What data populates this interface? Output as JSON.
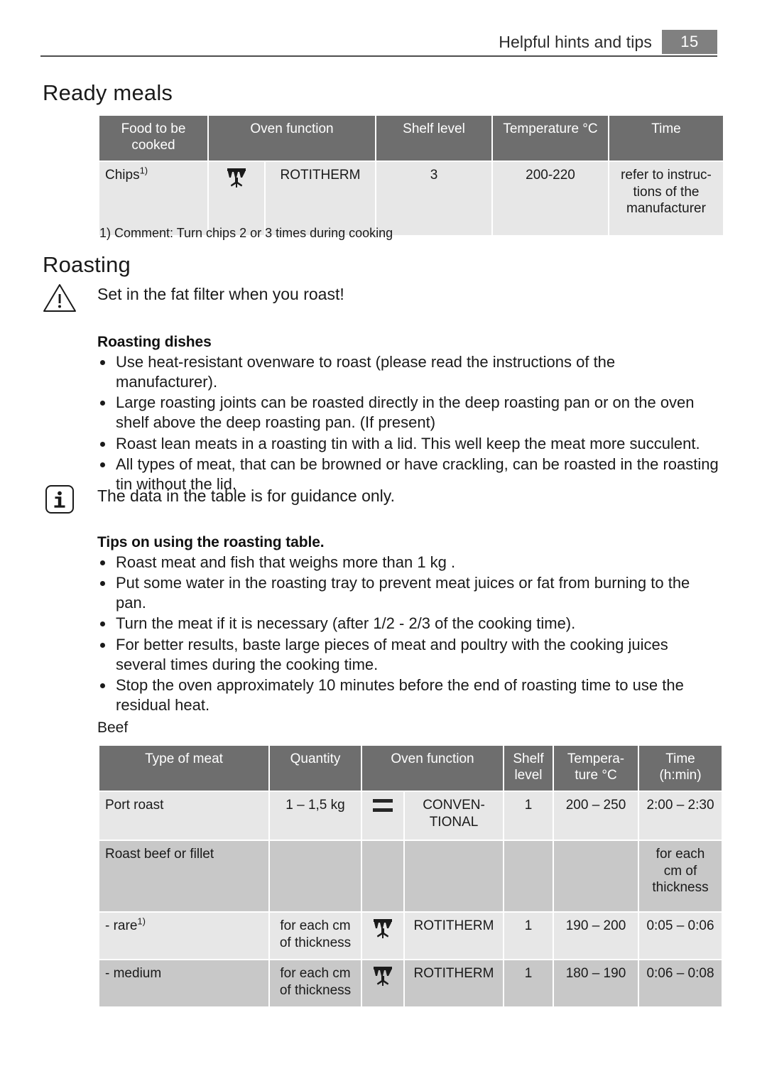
{
  "header": {
    "title": "Helpful hints and tips",
    "page_number": "15",
    "badge_color": "#808080"
  },
  "sections": {
    "ready_meals": {
      "heading": "Ready meals",
      "footnote": "1) Comment: Turn chips 2 or 3 times during cooking",
      "table": {
        "columns": [
          "Food to be cooked",
          "Oven function",
          "Shelf level",
          "Temperature °C",
          "Time"
        ],
        "rows": [
          {
            "food": "Chips",
            "food_footnote": "1)",
            "icon": "rotitherm-icon",
            "function": "ROTITHERM",
            "shelf_level": "3",
            "temperature": "200-220",
            "time": "refer to instruc-\ntions of the\nmanufacturer"
          }
        ]
      }
    },
    "roasting": {
      "heading": "Roasting",
      "warning": {
        "icon": "warning-triangle-icon",
        "text": "Set in the fat filter when you roast!"
      },
      "roasting_dishes": {
        "heading": "Roasting dishes",
        "bullets": [
          "Use heat-resistant ovenware to roast (please read the instructions of the manufacturer).",
          "Large roasting joints can be roasted directly in the deep roasting pan or on the oven shelf above the deep roasting pan. (If present)",
          "Roast lean meats in a roasting tin with a lid. This well keep the meat more succulent.",
          "All types of meat, that can be browned or have crackling, can be roasted in the roasting tin without the lid."
        ]
      },
      "info": {
        "icon": "info-icon",
        "text": "The data in the table is for guidance only."
      },
      "tips": {
        "heading": "Tips on using the roasting table.",
        "bullets": [
          "Roast meat and fish that weighs more than 1 kg .",
          "Put some water in the roasting tray to prevent meat juices or fat from burning to the pan.",
          "Turn the meat if it is necessary (after 1/2 - 2/3 of the cooking time).",
          "For better results, baste large pieces of meat and poultry with the cooking juices several times during the cooking time.",
          "Stop the oven approximately 10 minutes before the end of roasting time to use the residual heat."
        ]
      },
      "beef": {
        "label": "Beef",
        "table": {
          "columns": [
            "Type of meat",
            "Quantity",
            "Oven function",
            "Shelf level",
            "Tempera- ture °C",
            "Time (h:min)"
          ],
          "columns_multiline": [
            "Type of meat",
            "Quantity",
            "Oven function",
            "Shelf\nlevel",
            "Tempera-\nture °C",
            "Time\n(h:min)"
          ],
          "rows": [
            {
              "meat": "Port roast",
              "meat_footnote": "",
              "quantity": "1 – 1,5 kg",
              "icon": "conventional-icon",
              "function": "CONVEN-\nTIONAL",
              "shelf_level": "1",
              "temperature": "200 – 250",
              "time": "2:00 – 2:30",
              "shade": "light"
            },
            {
              "meat": "Roast beef or fillet",
              "meat_footnote": "",
              "quantity": "",
              "icon": "",
              "function": "",
              "shelf_level": "",
              "temperature": "",
              "time": "for each\ncm of\nthickness",
              "shade": "dark"
            },
            {
              "meat": "- rare",
              "meat_footnote": "1)",
              "quantity": "for each cm\nof thickness",
              "icon": "rotitherm-icon",
              "function": "ROTITHERM",
              "shelf_level": "1",
              "temperature": "190 – 200",
              "time": "0:05 – 0:06",
              "shade": "light"
            },
            {
              "meat": "- medium",
              "meat_footnote": "",
              "quantity": "for each cm\nof thickness",
              "icon": "rotitherm-icon",
              "function": "ROTITHERM",
              "shelf_level": "1",
              "temperature": "180 – 190",
              "time": "0:06 – 0:08",
              "shade": "dark"
            }
          ]
        }
      }
    }
  },
  "colors": {
    "table_header_bg": "#6e6e6e",
    "row_light": "#e7e7e7",
    "row_dark": "#c8c8c8",
    "text": "#1a1a1a"
  }
}
